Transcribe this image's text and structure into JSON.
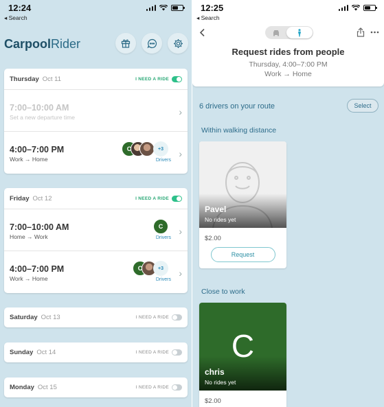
{
  "left": {
    "status": {
      "time": "12:24",
      "back": "◂ Search"
    },
    "brand": {
      "part1": "Carpool",
      "part2": "Rider"
    },
    "icons": [
      "gift-icon",
      "chat-icon",
      "settings-icon"
    ],
    "days": [
      {
        "name": "Thursday",
        "date": "Oct 11",
        "need_label": "I NEED A RIDE",
        "enabled": true,
        "rows": [
          {
            "time": "7:00–10:00 AM",
            "sub": "Set a new departure time"
          },
          {
            "time": "4:00–7:00 PM",
            "sub": "Work → Home",
            "avatar_letter": "C",
            "more": "+3",
            "drivers_label": "Drivers"
          }
        ]
      },
      {
        "name": "Friday",
        "date": "Oct 12",
        "need_label": "I NEED A RIDE",
        "enabled": true,
        "rows": [
          {
            "time": "7:00–10:00 AM",
            "sub": "Home → Work",
            "avatar_letter": "C",
            "drivers_label": "Drivers"
          },
          {
            "time": "4:00–7:00 PM",
            "sub": "Work → Home",
            "avatar_letter": "C",
            "more": "+3",
            "drivers_label": "Drivers"
          }
        ]
      },
      {
        "name": "Saturday",
        "date": "Oct 13",
        "need_label": "I NEED A RIDE",
        "enabled": false
      },
      {
        "name": "Sunday",
        "date": "Oct 14",
        "need_label": "I NEED A RIDE",
        "enabled": false
      },
      {
        "name": "Monday",
        "date": "Oct 15",
        "need_label": "I NEED A RIDE",
        "enabled": false
      }
    ]
  },
  "right": {
    "status": {
      "time": "12:25",
      "back": "◂ Search"
    },
    "title": "Request rides from people",
    "subtitle": "Thursday, 4:00–7:00 PM",
    "route": "Work → Home",
    "driver_count": "6 drivers on your route",
    "select_label": "Select",
    "sections": [
      {
        "title": "Within walking distance",
        "driver": {
          "name": "Pavel",
          "rides": "No rides yet",
          "price": "$2.00",
          "request_label": "Request"
        }
      },
      {
        "title": "Close to work",
        "driver": {
          "letter": "C",
          "name": "chris",
          "rides": "No rides yet",
          "price": "$2.00"
        }
      }
    ]
  },
  "colors": {
    "accent": "#2d6c8a",
    "toggle_on": "#2ec08a",
    "brand_dark": "#1e4f66",
    "driver_green": "#2e6b2a"
  }
}
